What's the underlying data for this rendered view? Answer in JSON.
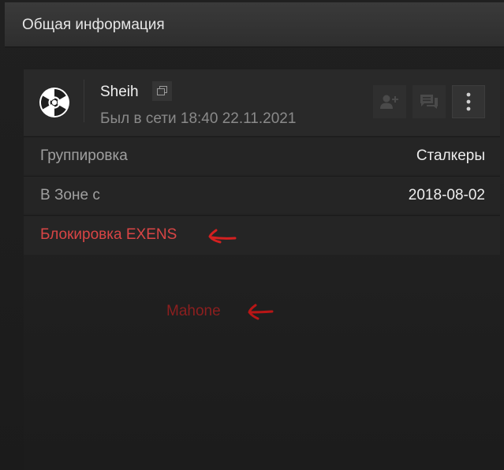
{
  "header": {
    "title": "Общая информация"
  },
  "profile": {
    "name": "Sheih",
    "last_seen": "Был в сети 18:40 22.11.2021",
    "avatar_icon": "radiation-icon"
  },
  "actions": [
    {
      "icon": "add-friend-icon"
    },
    {
      "icon": "message-icon"
    },
    {
      "icon": "more-vertical-icon"
    }
  ],
  "rows": {
    "group": {
      "label": "Группировка",
      "value": "Сталкеры"
    },
    "zone": {
      "label": "В Зоне с",
      "value": "2018-08-02"
    },
    "block": {
      "label": "Блокировка EXENS"
    }
  },
  "annotation": {
    "text": "Mahone"
  },
  "colors": {
    "blocked": "#d94545",
    "annotation": "#8c1f1f",
    "background": "#1e1e1e"
  }
}
